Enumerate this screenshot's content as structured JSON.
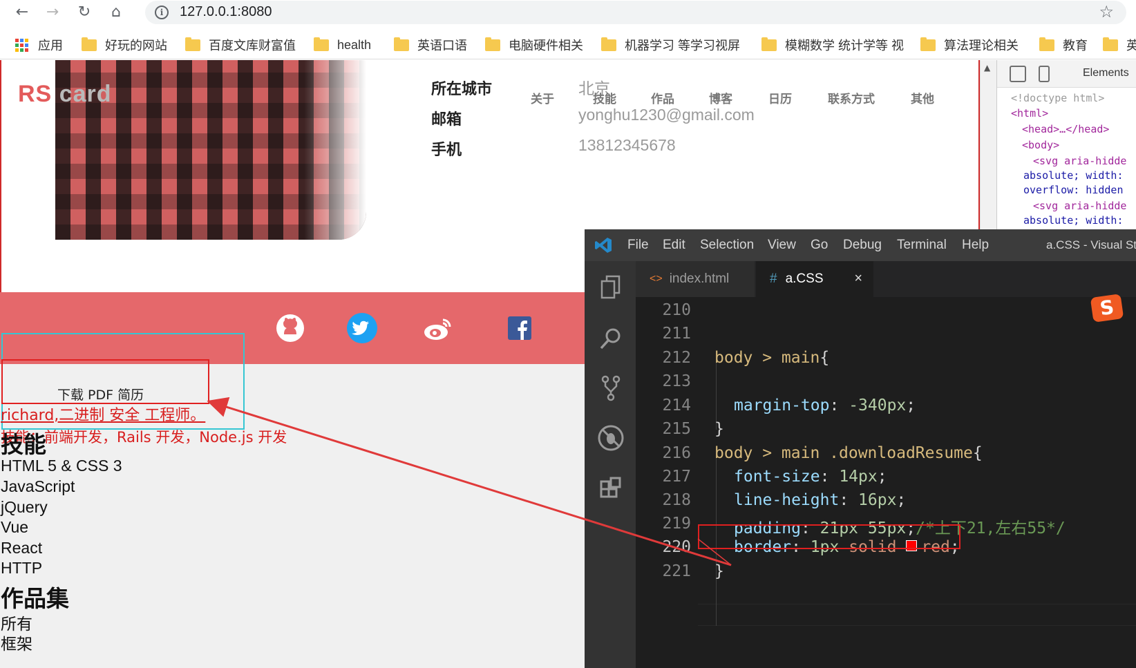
{
  "browser": {
    "url": "127.0.0.1:8080",
    "bookmarks": [
      "应用",
      "好玩的网站",
      "百度文库财富值",
      "health",
      "英语口语",
      "电脑硬件相关",
      "机器学习 等学习视屏",
      "模糊数学 统计学等 视",
      "算法理论相关",
      "教育",
      "英"
    ]
  },
  "page": {
    "logo": {
      "rs": "RS",
      "card": "card"
    },
    "info": [
      {
        "label": "所在城市",
        "value": "北京"
      },
      {
        "label": "邮箱",
        "value": "yonghu1230@gmail.com"
      },
      {
        "label": "手机",
        "value": "13812345678"
      }
    ],
    "nav": [
      "关于",
      "技能",
      "作品",
      "博客",
      "日历",
      "联系方式",
      "其他"
    ],
    "download": "下载 PDF 简历",
    "intro": "richard,二进制 安全 工程师。",
    "skills_line": "技能：前端开发，Rails 开发，Node.js 开发",
    "skills_title": "技能",
    "skills": [
      "HTML 5 & CSS 3",
      "JavaScript",
      "jQuery",
      "Vue",
      "React",
      "HTTP"
    ],
    "works_title": "作品集",
    "works": [
      "所有",
      "框架"
    ]
  },
  "devtools": {
    "tab": "Elements",
    "lines": [
      "<!doctype html>",
      "<html>",
      "<head>…</head>",
      "<body>",
      "<svg aria-hidde",
      "absolute; width:",
      "overflow: hidden",
      "<svg aria-hidde",
      "absolute; width:"
    ]
  },
  "vscode": {
    "menu": [
      "File",
      "Edit",
      "Selection",
      "View",
      "Go",
      "Debug",
      "Terminal",
      "Help"
    ],
    "window_title": "a.CSS - Visual Stu",
    "tabs": [
      {
        "name": "index.html",
        "icon": "<>"
      },
      {
        "name": "a.CSS",
        "icon": "#",
        "close": "×"
      }
    ],
    "line_numbers": [
      "210",
      "211",
      "212",
      "213",
      "214",
      "215",
      "216",
      "217",
      "218",
      "219",
      "220",
      "221"
    ],
    "code": {
      "l212_sel": "body > main",
      "l212_brace": "{",
      "l214_prop": "margin-top",
      "l214_val": "-340px",
      "l215": "}",
      "l216_sel": "body > main .downloadResume",
      "l216_brace": "{",
      "l217_prop": "font-size",
      "l217_val": "14px",
      "l218_prop": "line-height",
      "l218_val": "16px",
      "l219_prop": "padding",
      "l219_val": "21px 55px",
      "l219_cmt": "/*上下21,左右55*/",
      "l220_prop": "border",
      "l220_num": "1px",
      "l220_solid": "solid",
      "l220_color": "red",
      "l221": "}"
    },
    "sogou": "S"
  },
  "colors": {
    "accent_red": "#e5686b",
    "annotation_red": "#e02020",
    "annotation_cyan": "#35c6d3",
    "vscode_bg": "#1e1e1e"
  }
}
